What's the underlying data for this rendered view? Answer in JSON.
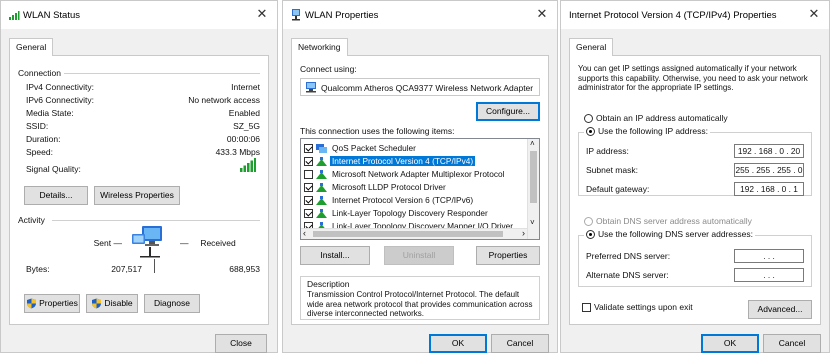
{
  "wlan_status": {
    "title": "WLAN Status",
    "tab": "General",
    "connection": {
      "heading": "Connection",
      "rows": [
        {
          "label": "IPv4 Connectivity:",
          "value": "Internet"
        },
        {
          "label": "IPv6 Connectivity:",
          "value": "No network access"
        },
        {
          "label": "Media State:",
          "value": "Enabled"
        },
        {
          "label": "SSID:",
          "value": "SZ_5G"
        },
        {
          "label": "Duration:",
          "value": "00:00:06"
        },
        {
          "label": "Speed:",
          "value": "433.3 Mbps"
        }
      ],
      "signal_label": "Signal Quality:"
    },
    "details_button": "Details...",
    "wireless_properties_button": "Wireless Properties",
    "activity": {
      "heading": "Activity",
      "sent_label": "Sent",
      "received_label": "Received",
      "bytes_label": "Bytes:",
      "sent_bytes": "207,517",
      "received_bytes": "688,953"
    },
    "properties_button": "Properties",
    "disable_button": "Disable",
    "diagnose_button": "Diagnose",
    "close_button": "Close"
  },
  "wlan_properties": {
    "title": "WLAN Properties",
    "tab": "Networking",
    "connect_using_label": "Connect using:",
    "adapter_name": "Qualcomm Atheros QCA9377 Wireless Network Adapter",
    "configure_button": "Configure...",
    "items_label": "This connection uses the following items:",
    "items": [
      {
        "label": "QoS Packet Scheduler",
        "checked": true,
        "selected": false
      },
      {
        "label": "Internet Protocol Version 4 (TCP/IPv4)",
        "checked": true,
        "selected": true
      },
      {
        "label": "Microsoft Network Adapter Multiplexor Protocol",
        "checked": false,
        "selected": false
      },
      {
        "label": "Microsoft LLDP Protocol Driver",
        "checked": true,
        "selected": false
      },
      {
        "label": "Internet Protocol Version 6 (TCP/IPv6)",
        "checked": true,
        "selected": false
      },
      {
        "label": "Link-Layer Topology Discovery Responder",
        "checked": true,
        "selected": false
      },
      {
        "label": "Link-Layer Topology Discovery Mapper I/O Driver",
        "checked": true,
        "selected": false
      }
    ],
    "install_button": "Install...",
    "uninstall_button": "Uninstall",
    "properties_button": "Properties",
    "description_heading": "Description",
    "description_text": "Transmission Control Protocol/Internet Protocol. The default wide area network protocol that provides communication across diverse interconnected networks.",
    "ok_button": "OK",
    "cancel_button": "Cancel"
  },
  "ipv4_properties": {
    "title": "Internet Protocol Version 4 (TCP/IPv4) Properties",
    "tab": "General",
    "intro_text": "You can get IP settings assigned automatically if your network supports this capability. Otherwise, you need to ask your network administrator for the appropriate IP settings.",
    "obtain_ip_auto": "Obtain an IP address automatically",
    "use_following_ip": "Use the following IP address:",
    "ip_address_label": "IP address:",
    "ip_address": "192 . 168 . 0 . 20",
    "subnet_mask_label": "Subnet mask:",
    "subnet_mask": "255 . 255 . 255 . 0",
    "default_gateway_label": "Default gateway:",
    "default_gateway": "192 . 168 . 0 . 1",
    "obtain_dns_auto": "Obtain DNS server address automatically",
    "use_following_dns": "Use the following DNS server addresses:",
    "preferred_dns_label": "Preferred DNS server:",
    "preferred_dns": ". . .",
    "alternate_dns_label": "Alternate DNS server:",
    "alternate_dns": ". . .",
    "validate_label": "Validate settings upon exit",
    "advanced_button": "Advanced...",
    "ok_button": "OK",
    "cancel_button": "Cancel"
  },
  "colors": {
    "accent": "#0078d7",
    "signal_green": "#1e9e2e",
    "shield_blue": "#1f5fbf",
    "shield_yellow": "#f2c230"
  }
}
